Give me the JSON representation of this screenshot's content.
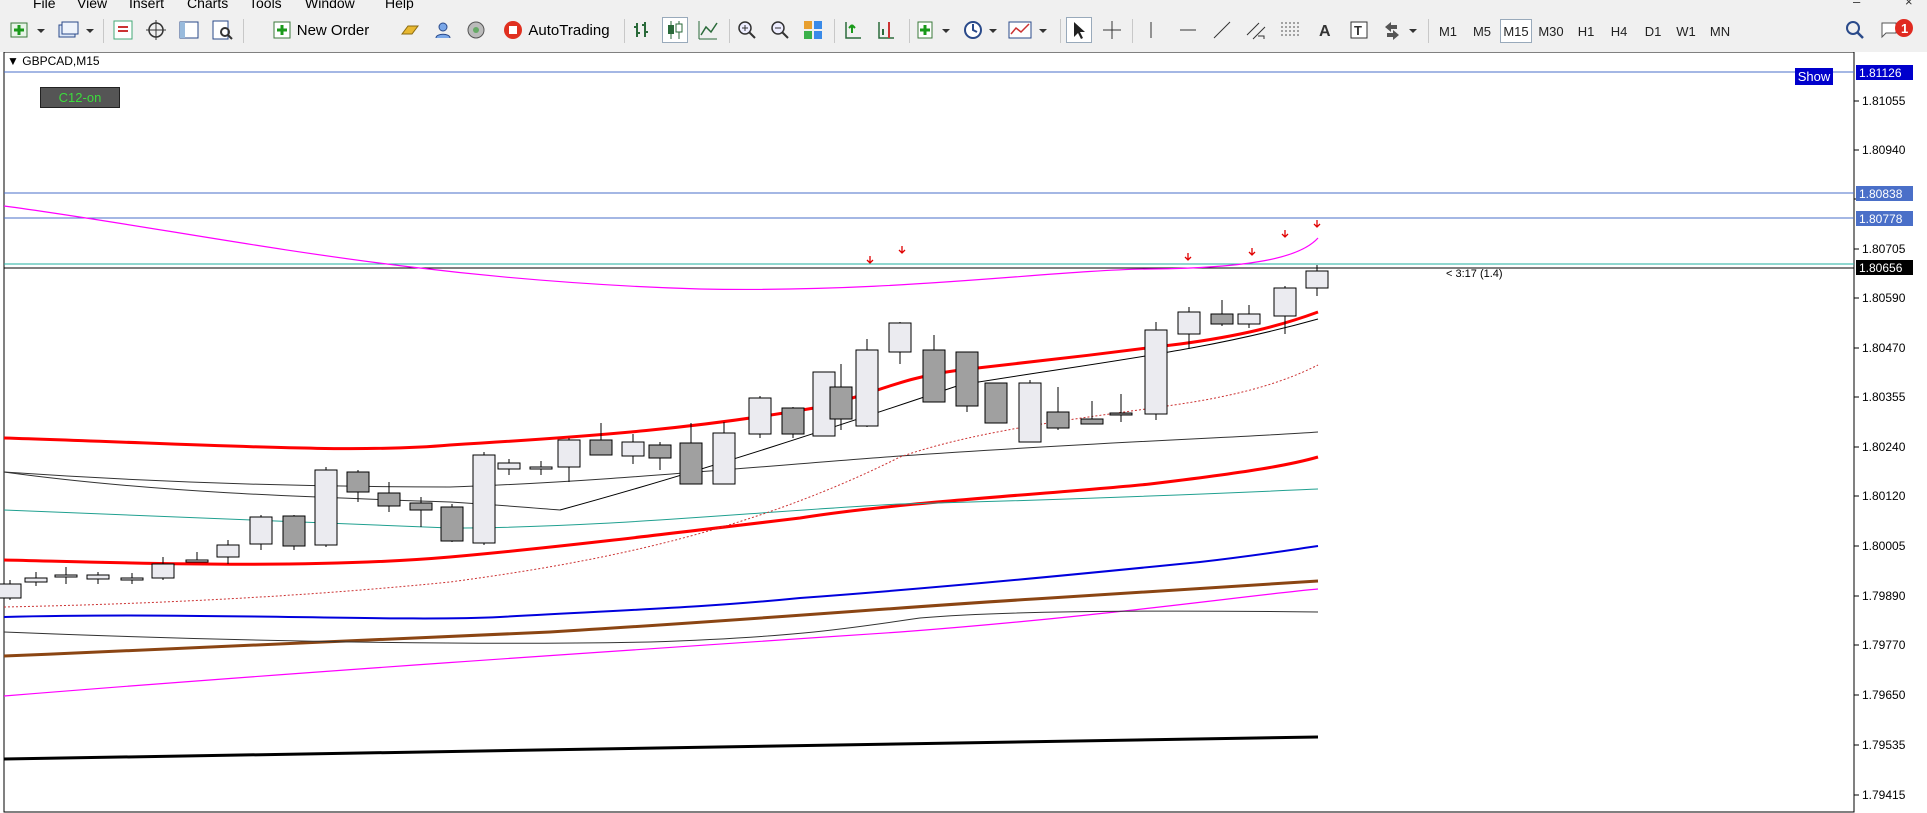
{
  "menu": {
    "items": [
      "File",
      "View",
      "Insert",
      "Charts",
      "Tools",
      "Window",
      "Help"
    ],
    "window_controls": [
      "minimize",
      "close"
    ]
  },
  "toolbar": {
    "new_order_label": "New Order",
    "autotrading_label": "AutoTrading",
    "timeframes": [
      "M1",
      "M5",
      "M15",
      "M30",
      "H1",
      "H4",
      "D1",
      "W1",
      "MN"
    ],
    "active_timeframe": "M15",
    "notification_count": "1"
  },
  "chart": {
    "symbol_label": "GBPCAD,M15",
    "indicator_badge": "C12-on",
    "show_button": "Show",
    "countdown": "< 3:17 (1.4)",
    "price_labels": [
      "1.81055",
      "1.80940",
      "1.80705",
      "1.80590",
      "1.80470",
      "1.80355",
      "1.80240",
      "1.80120",
      "1.80005",
      "1.79890",
      "1.79770",
      "1.79650",
      "1.79535",
      "1.79415"
    ],
    "level_labels": {
      "top_blue": "1.81126",
      "upper_blue": "1.80838",
      "mid_blue": "1.80778",
      "current_price": "1.80656"
    },
    "colors": {
      "bull_candle": "#ebebf0",
      "bear_candle": "#a0a0a0",
      "ma_red": "#ff0000",
      "ma_blue": "#0000dd",
      "ma_brown": "#8b4513",
      "ma_magenta": "#ff00ff",
      "level_line": "#4a6fc8",
      "price_box": "#000000"
    }
  }
}
